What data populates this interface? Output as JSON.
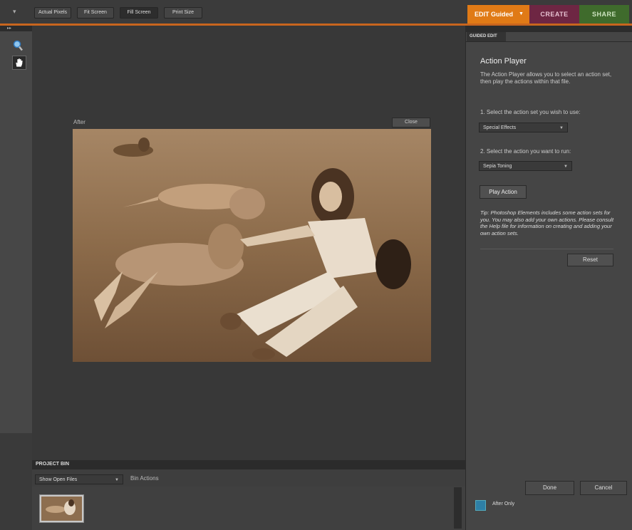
{
  "toolbar": {
    "buttons": [
      {
        "label": "Actual Pixels",
        "active": false
      },
      {
        "label": "Fit Screen",
        "active": false
      },
      {
        "label": "Fill Screen",
        "active": true
      },
      {
        "label": "Print Size",
        "active": false
      }
    ]
  },
  "mode_tabs": {
    "edit": "EDIT Guided",
    "create": "CREATE",
    "share": "SHARE",
    "colors": {
      "edit": "#e07a16",
      "create": "#6e2643",
      "share": "#3f6b2c"
    }
  },
  "canvas": {
    "view_label": "After",
    "close_label": "Close",
    "image_description_icon": "sepia-photo-icon"
  },
  "panel": {
    "tab": "GUIDED EDIT",
    "title": "Action Player",
    "description": "The Action Player allows you to select an action set, then play the actions within that file.",
    "step1": "1. Select the action set you wish to use:",
    "action_set_value": "Special Effects",
    "step2": "2. Select the action you want to run:",
    "action_value": "Sepia Toning",
    "play_label": "Play Action",
    "tip": "Tip: Photoshop Elements includes some action sets for you. You may also add your own actions. Please consult the Help file for information on creating and adding your own action sets.",
    "reset_label": "Reset",
    "done_label": "Done",
    "cancel_label": "Cancel",
    "after_only_label": "After Only"
  },
  "bin": {
    "title": "PROJECT BIN",
    "show_select": "Show Open Files",
    "bin_actions": "Bin Actions"
  }
}
